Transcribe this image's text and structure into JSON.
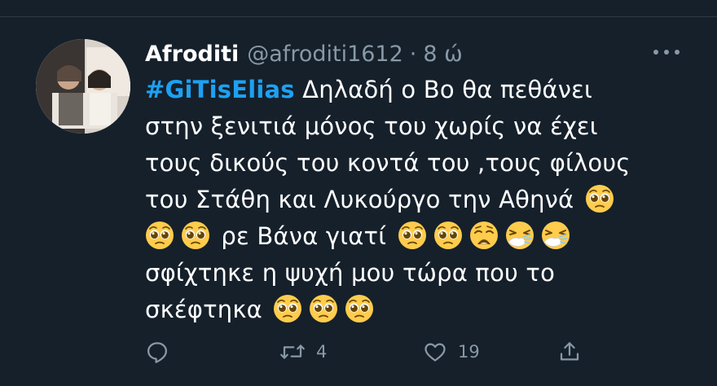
{
  "tweet": {
    "author_name": "Afroditi",
    "author_handle": "@afroditi1612",
    "separator": "·",
    "time": "8 ώ",
    "hashtag": "#GiTisElias",
    "lines": [
      "Δηλαδή ο Βο θα πεθάνει",
      "στην ξενιτιά μόνος του χωρίς να έχει",
      "τους δικούς του κοντά του ,τους φίλους",
      "του Στάθη και Λυκούργο την Αθηνά",
      "ρε Βάνα γιατί",
      "σφίχτηκε η ψυχή μου τώρα που το",
      "σκέφτηκα"
    ],
    "emojis": {
      "pleading": "pleading-face",
      "weary": "weary-face",
      "sneezing": "sneezing-face"
    }
  },
  "actions": {
    "reply_count": "",
    "retweet_count": "4",
    "like_count": "19",
    "share_count": ""
  },
  "colors": {
    "background": "#15202b",
    "text": "#ffffff",
    "secondary": "#8899a6",
    "hashtag": "#1da1f2",
    "emoji_face": "#ffcc4d"
  }
}
